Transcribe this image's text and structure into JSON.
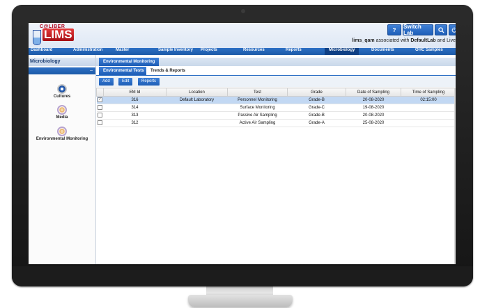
{
  "app": {
    "logo_caliber": "C@LIBER",
    "logo_lims": "LIMS",
    "switch_lab_label": "Switch Lab",
    "help_label": "?",
    "search_icon": "magnifier-icon",
    "user_name": "lims_qam",
    "associated_text": "associated with",
    "lab_name": "DefaultLab",
    "mode_text": "and Live"
  },
  "nav": {
    "items": [
      "Dashboard",
      "Administration",
      "Master",
      "Sample Inventory",
      "Projects",
      "Resources",
      "Reports",
      "Microbiology",
      "Documents",
      "OHC Samples"
    ],
    "active": "Microbiology"
  },
  "sidebar": {
    "title": "Microbiology",
    "collapse_glyph": "–",
    "modules": [
      {
        "label": "Cultures",
        "icon": "cultures-icon"
      },
      {
        "label": "Media",
        "icon": "media-icon"
      },
      {
        "label": "Environmental Monitoring",
        "icon": "environmental-monitoring-icon"
      }
    ]
  },
  "main": {
    "tab": "Environmental Monitoring",
    "subtabs": [
      "Environmental Tests",
      "Trends & Reports"
    ],
    "toolbar": {
      "add": "Add",
      "edit": "Edit",
      "reports": "Reports"
    },
    "columns": [
      "EM Id",
      "Location",
      "Test",
      "Grade",
      "Date of Sampling",
      "Time of Sampling"
    ],
    "rows": [
      {
        "checked": true,
        "em_id": "316",
        "location": "Default Laboratory",
        "test": "Personnel Monitoring",
        "grade": "Grade-B",
        "date": "20-08-2020",
        "time": "02:15:00"
      },
      {
        "checked": false,
        "em_id": "314",
        "location": "",
        "test": "Surface Monitoring",
        "grade": "Grade-C",
        "date": "19-08-2020",
        "time": ""
      },
      {
        "checked": false,
        "em_id": "313",
        "location": "",
        "test": "Passive Air Sampling",
        "grade": "Grade-B",
        "date": "20-08-2020",
        "time": ""
      },
      {
        "checked": false,
        "em_id": "312",
        "location": "",
        "test": "Active Air Sampling",
        "grade": "Grade-A",
        "date": "25-08-2020",
        "time": ""
      }
    ]
  },
  "colors": {
    "accent": "#1f5fb8",
    "selected_row": "#c2d8f3",
    "bezel": "#1e1e1e"
  }
}
